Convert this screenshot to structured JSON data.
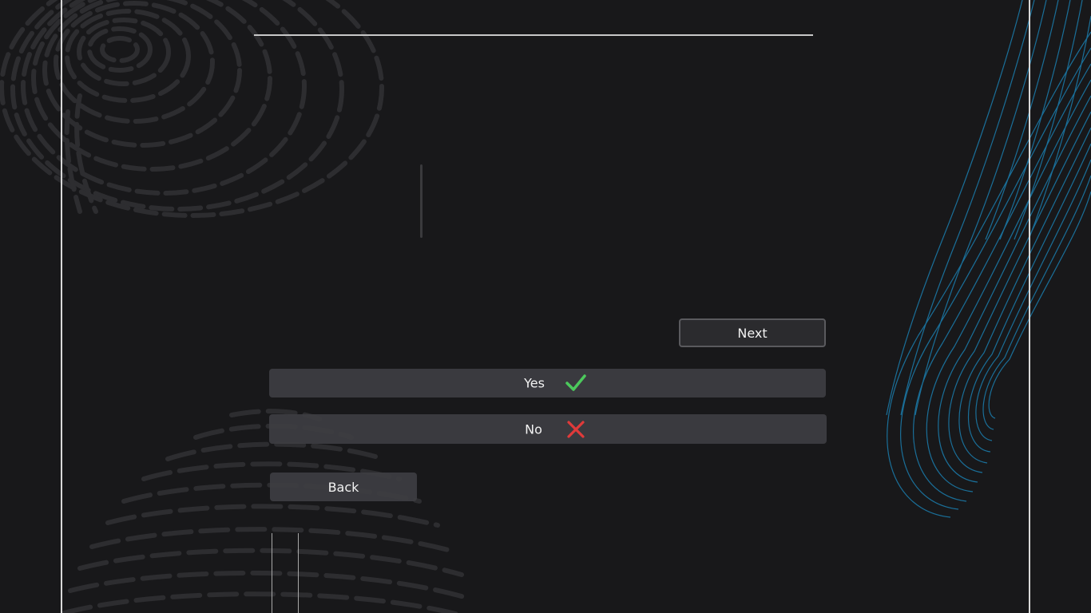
{
  "buttons": {
    "next_label": "Next",
    "yes_label": "Yes",
    "no_label": "No",
    "back_label": "Back"
  },
  "icons": {
    "yes_icon": "checkmark-icon",
    "no_icon": "close-icon"
  },
  "colors": {
    "background": "#18181a",
    "accent_blue": "#1a6f99",
    "check_green": "#4cc95c",
    "cross_red": "#e03a3a",
    "fingerprint_gray": "#2f2f32"
  }
}
